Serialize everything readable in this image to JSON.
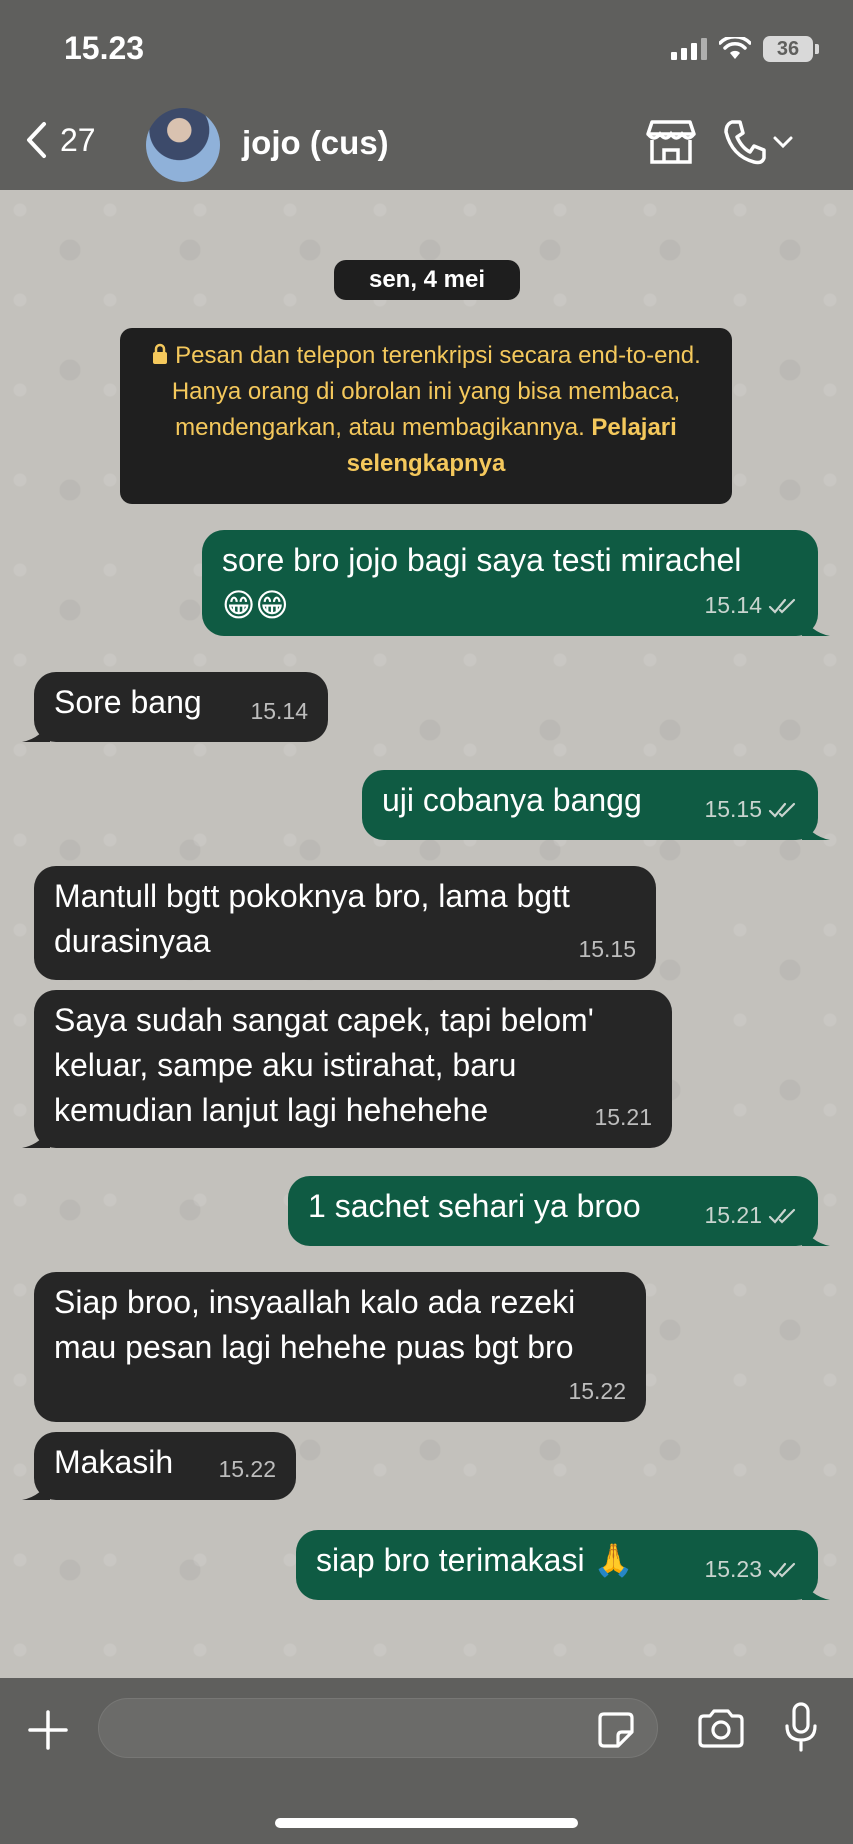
{
  "status_bar": {
    "time": "15.23",
    "battery": "36"
  },
  "header": {
    "back_count": "27",
    "contact_name": "jojo (cus)"
  },
  "chat": {
    "date_label": "sen, 4 mei",
    "encryption_notice": "Pesan dan telepon terenkripsi secara end-to-end. Hanya orang di obrolan ini yang bisa membaca, mendengarkan, atau membagikannya.",
    "encryption_link": "Pelajari selengkapnya",
    "messages": [
      {
        "dir": "out",
        "text": "sore bro jojo bagi saya testi mirachel\n😁😁",
        "time": "15.14",
        "read": true
      },
      {
        "dir": "in",
        "text": "Sore bang",
        "time": "15.14"
      },
      {
        "dir": "out",
        "text": "uji cobanya bangg",
        "time": "15.15",
        "read": true
      },
      {
        "dir": "in",
        "text": "Mantull bgtt pokoknya bro, lama bgtt\ndurasinyaa",
        "time": "15.15"
      },
      {
        "dir": "in",
        "text": "Saya sudah sangat capek, tapi belom'\nkeluar, sampe aku istirahat, baru\nkemudian lanjut lagi hehehehe",
        "time": "15.21"
      },
      {
        "dir": "out",
        "text": "1 sachet sehari ya broo",
        "time": "15.21",
        "read": true
      },
      {
        "dir": "in",
        "text": "Siap broo, insyaallah kalo ada rezeki\nmau pesan lagi hehehe puas bgt bro",
        "time": "15.22"
      },
      {
        "dir": "in",
        "text": "Makasih",
        "time": "15.22"
      },
      {
        "dir": "out",
        "text": "siap bro terimakasi 🙏",
        "time": "15.23",
        "read": true
      }
    ]
  },
  "input_bar": {
    "placeholder": ""
  },
  "icons": [
    "chevron-left-icon",
    "store-icon",
    "phone-icon",
    "chevron-down-icon",
    "plus-icon",
    "sticker-icon",
    "camera-icon",
    "mic-icon",
    "lock-icon",
    "double-check-icon"
  ],
  "colors": {
    "outgoing": "#0f5b43",
    "incoming": "#262626",
    "chat_bg": "#c3c1bc",
    "header_bg": "#5f5f5d",
    "notice_text": "#f4c85c"
  }
}
